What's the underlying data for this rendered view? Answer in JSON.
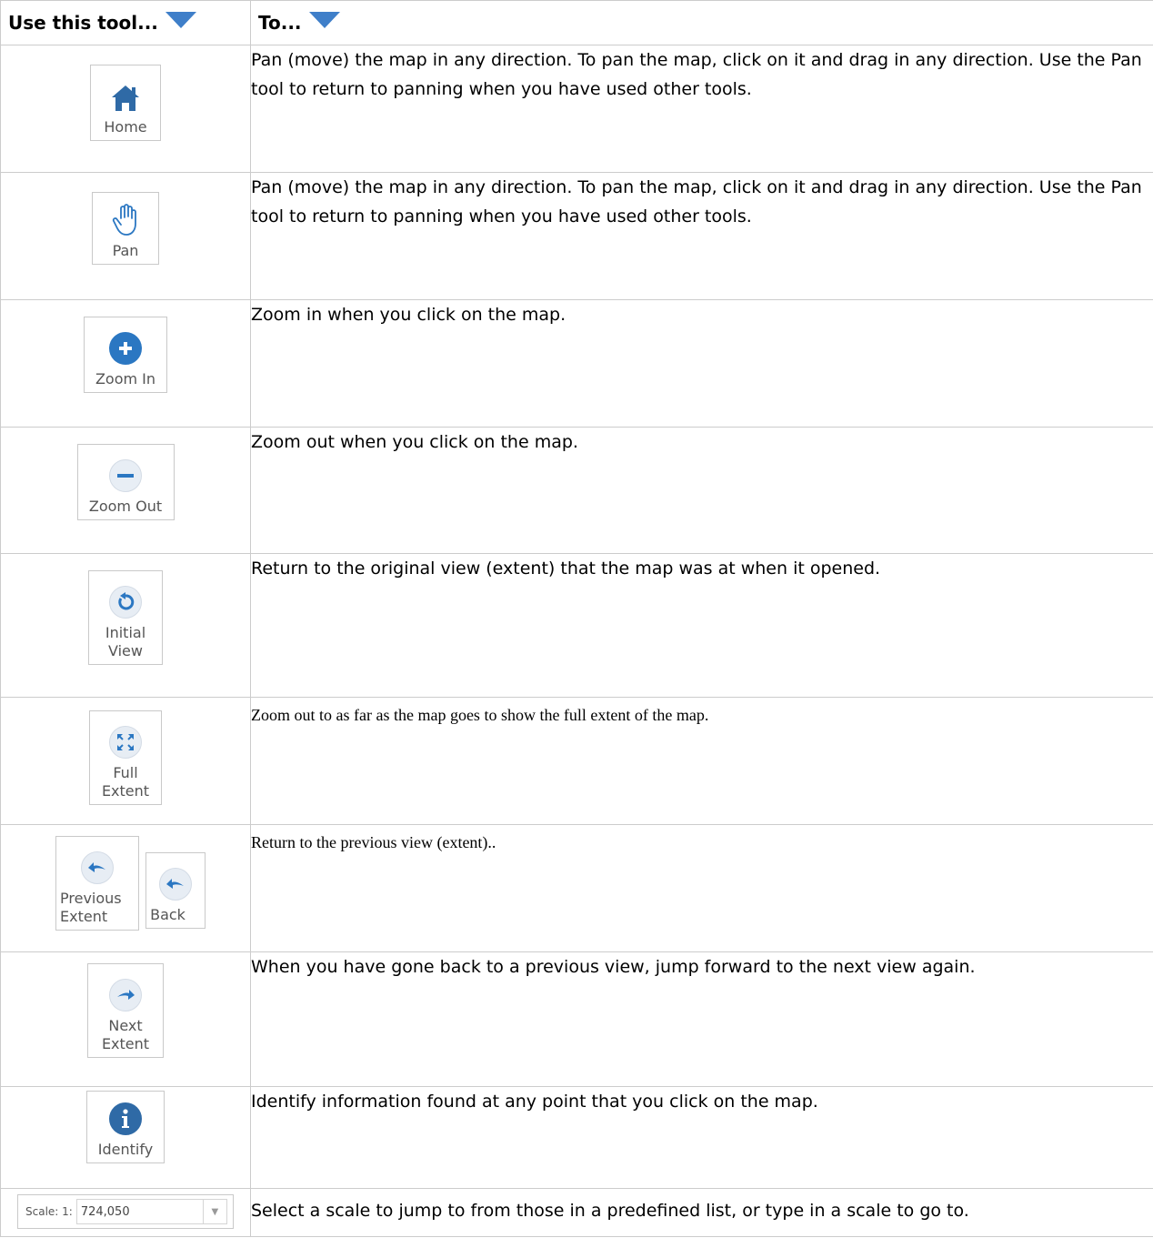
{
  "header": {
    "col1": "Use this tool...",
    "col2": "To..."
  },
  "rows": [
    {
      "tool": "Home",
      "desc": "Pan (move) the map in any direction. To pan the map, click on it and drag in any direction. Use the Pan tool to return to panning when you have used other tools."
    },
    {
      "tool": "Pan",
      "desc": "Pan (move) the map in any direction. To pan the map, click on it and drag in any direction. Use the Pan tool to return to panning when you have used other tools."
    },
    {
      "tool": "Zoom In",
      "desc": "Zoom in when you click on the map."
    },
    {
      "tool": "Zoom Out",
      "desc": "Zoom out when you click on the map."
    },
    {
      "tool_l1": "Initial",
      "tool_l2": "View",
      "desc": "Return to the original view (extent) that the map was at when it opened."
    },
    {
      "tool_l1": "Full",
      "tool_l2": "Extent",
      "desc": "Zoom out to as far as the map goes to show the full extent of the map."
    },
    {
      "tool_l1": "Previous",
      "tool_l2": "Extent",
      "tool_b": "Back",
      "desc": "Return to the previous view (extent).."
    },
    {
      "tool_l1": "Next",
      "tool_l2": "Extent",
      "desc": "When you have gone back to a previous view, jump forward to the next view again."
    },
    {
      "tool": "Identify",
      "desc": "Identify information found at any point that you click on the map."
    },
    {
      "scale_label": "Scale: 1:",
      "scale_value": "724,050",
      "desc": "Select a scale to jump to from those in a predefined list, or type in a scale to go to."
    }
  ],
  "colors": {
    "accent": "#2b77c2",
    "header_triangle": "#3f7fc9",
    "border": "#cccccc"
  },
  "icons": [
    "home-icon",
    "pan-hand-icon",
    "zoom-in-icon",
    "zoom-out-icon",
    "initial-view-icon",
    "full-extent-icon",
    "previous-extent-icon",
    "back-icon",
    "next-extent-icon",
    "identify-icon",
    "dropdown-arrow-icon"
  ]
}
